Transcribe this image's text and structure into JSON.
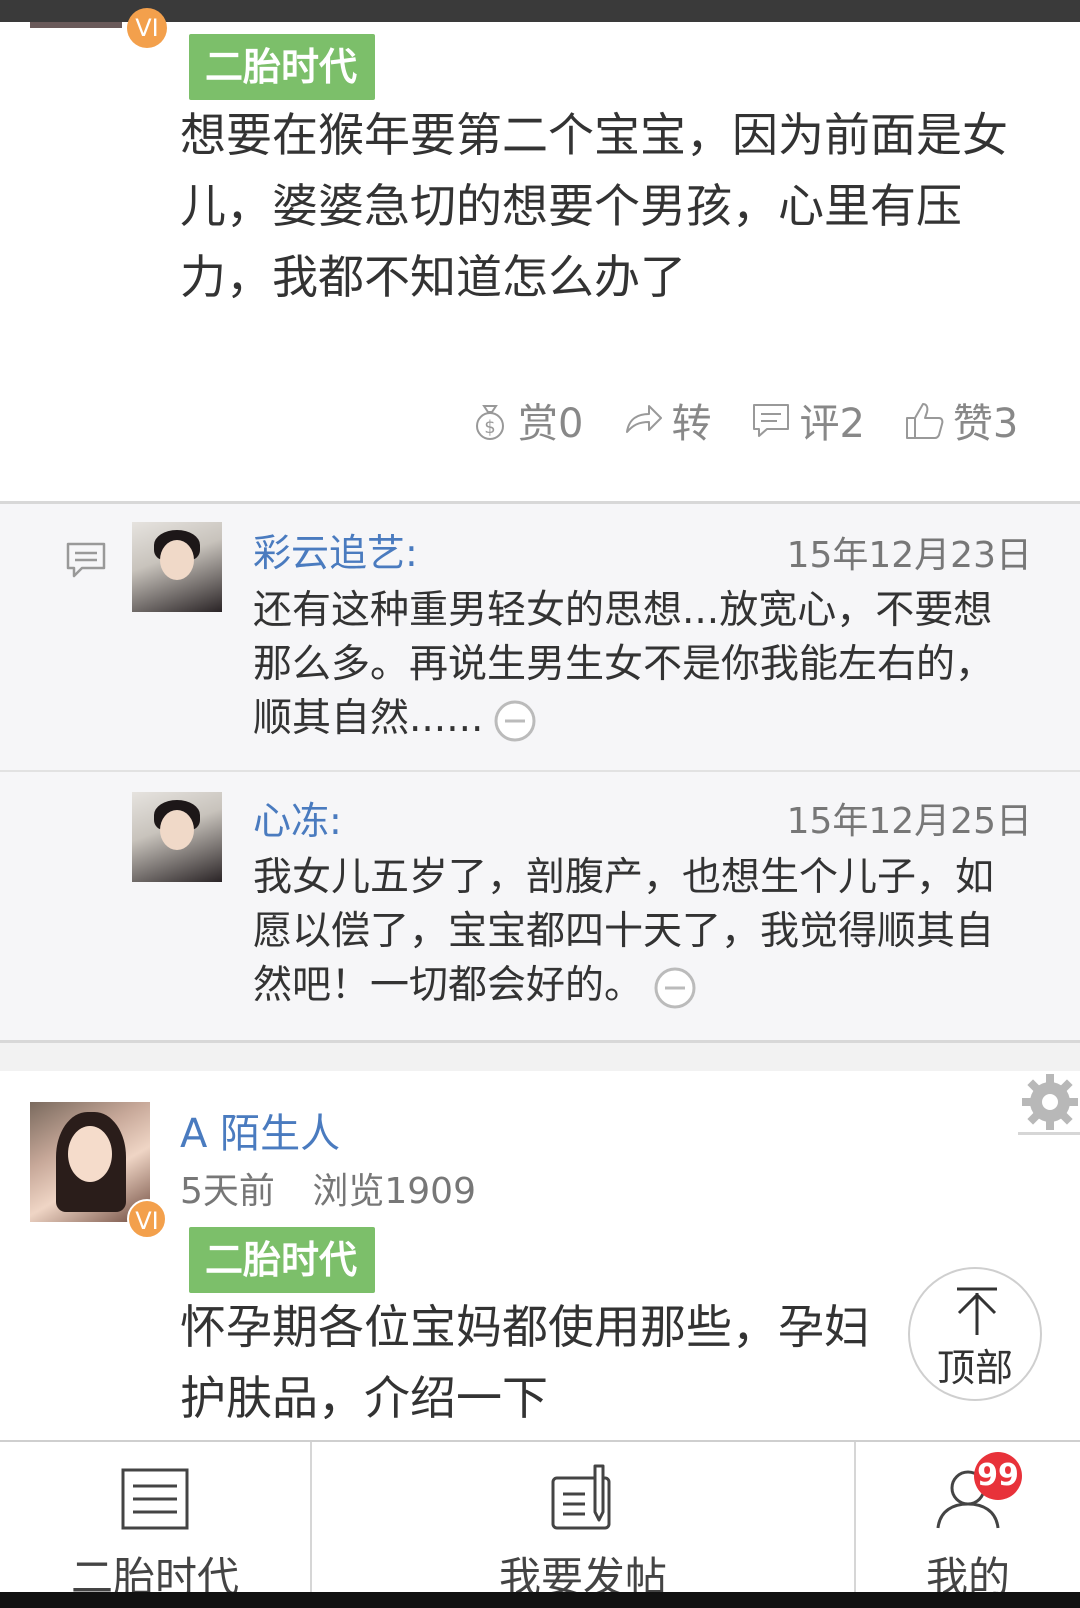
{
  "post1": {
    "vip_label": "VI",
    "tag": "二胎时代",
    "text": "想要在猴年要第二个宝宝，因为前面是女儿，婆婆急切的想要个男孩，心里有压力，我都不知道怎么办了",
    "actions": {
      "reward": "赏0",
      "share": "转",
      "comment": "评2",
      "like": "赞3"
    }
  },
  "comments": [
    {
      "name": "彩云追艺:",
      "date": "15年12月23日",
      "text": "还有这种重男轻女的思想...放宽心，不要想那么多。再说生男生女不是你我能左右的，顺其自然......"
    },
    {
      "name": "心冻:",
      "date": "15年12月25日",
      "text": "我女儿五岁了，剖腹产，也想生个儿子，如愿以偿了，宝宝都四十天了，我觉得顺其自然吧！一切都会好的。"
    }
  ],
  "post2": {
    "name": "A 陌生人",
    "time": "5天前",
    "views": "浏览1909",
    "vip_label": "VI",
    "tag": "二胎时代",
    "text": "怀孕期各位宝妈都使用那些，孕妇护肤品，介绍一下"
  },
  "top_button": {
    "label": "顶部"
  },
  "bottom_nav": {
    "tab1": "二胎时代",
    "tab2": "我要发帖",
    "tab3": "我的",
    "badge": "99"
  },
  "colors": {
    "tag_green": "#7cbf6a",
    "name_blue": "#4a7bbf",
    "vip_orange": "#f3a04c",
    "badge_red": "#e8323a"
  }
}
